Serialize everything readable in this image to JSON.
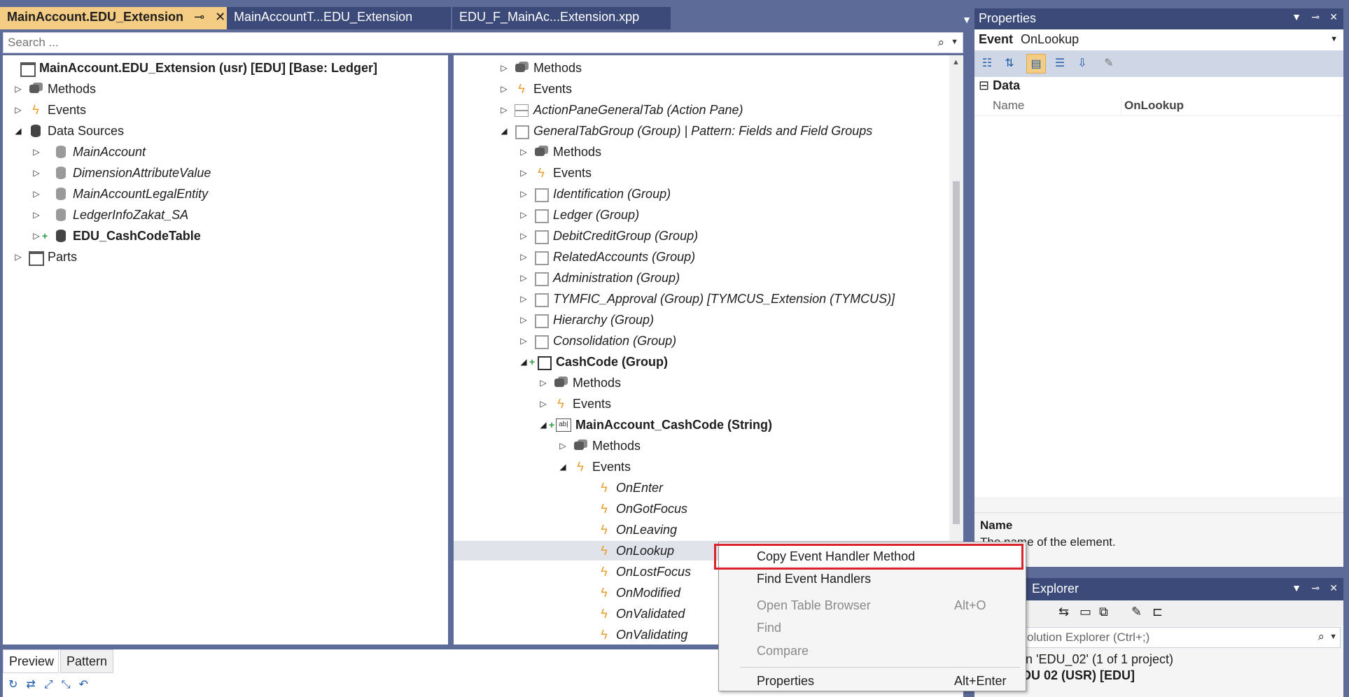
{
  "tabs": [
    {
      "label": "MainAccount.EDU_Extension",
      "active": true
    },
    {
      "label": "MainAccountT...EDU_Extension",
      "active": false
    },
    {
      "label": "EDU_F_MainAc...Extension.xpp",
      "active": false
    }
  ],
  "search": {
    "placeholder": "Search ..."
  },
  "left_tree": {
    "root": "MainAccount.EDU_Extension (usr) [EDU] [Base: Ledger]",
    "methods": "Methods",
    "events": "Events",
    "data_sources": "Data Sources",
    "ds_items": [
      "MainAccount",
      "DimensionAttributeValue",
      "MainAccountLegalEntity",
      "LedgerInfoZakat_SA",
      "EDU_CashCodeTable"
    ],
    "parts": "Parts"
  },
  "right_tree": {
    "methods": "Methods",
    "events": "Events",
    "action_pane": "ActionPaneGeneralTab (Action Pane)",
    "general_group": "GeneralTabGroup (Group) | Pattern: Fields and Field Groups",
    "gg_methods": "Methods",
    "gg_events": "Events",
    "groups": [
      "Identification (Group)",
      "Ledger (Group)",
      "DebitCreditGroup (Group)",
      "RelatedAccounts (Group)",
      "Administration (Group)",
      "TYMFIC_Approval (Group) [TYMCUS_Extension (TYMCUS)]",
      "Hierarchy (Group)",
      "Consolidation (Group)"
    ],
    "cashcode_group": "CashCode (Group)",
    "cc_methods": "Methods",
    "cc_events": "Events",
    "cashcode_field": "MainAccount_CashCode (String)",
    "field_methods": "Methods",
    "field_events": "Events",
    "event_items": [
      "OnEnter",
      "OnGotFocus",
      "OnLeaving",
      "OnLookup",
      "OnLostFocus",
      "OnModified",
      "OnValidated",
      "OnValidating"
    ]
  },
  "bottom_tabs": {
    "preview": "Preview",
    "pattern": "Pattern"
  },
  "properties": {
    "title": "Properties",
    "selected_kind": "Event",
    "selected_name": "OnLookup",
    "category": "Data",
    "prop_name_key": "Name",
    "prop_name_value": "OnLookup",
    "desc_title": "Name",
    "desc_text": "The name of the element."
  },
  "solution": {
    "title": "Explorer",
    "search_placeholder": "olution Explorer (Ctrl+;)",
    "line1": "ution 'EDU_02' (1 of 1 project)",
    "line2": "EDU 02 (USR) [EDU]"
  },
  "context_menu": {
    "items": [
      {
        "label": "Copy Event Handler Method",
        "shortcut": "",
        "disabled": false
      },
      {
        "label": "Find Event Handlers",
        "shortcut": "",
        "disabled": false
      },
      {
        "label": "Open Table Browser",
        "shortcut": "Alt+O",
        "disabled": true
      },
      {
        "label": "Find",
        "shortcut": "",
        "disabled": true
      },
      {
        "label": "Compare",
        "shortcut": "",
        "disabled": true
      },
      {
        "label": "Properties",
        "shortcut": "Alt+Enter",
        "disabled": false
      }
    ]
  },
  "colors": {
    "accent": "#f5cc84",
    "title_bar": "#3c4a7a",
    "highlight_box": "#d9232e",
    "event_icon": "#e8a030"
  }
}
